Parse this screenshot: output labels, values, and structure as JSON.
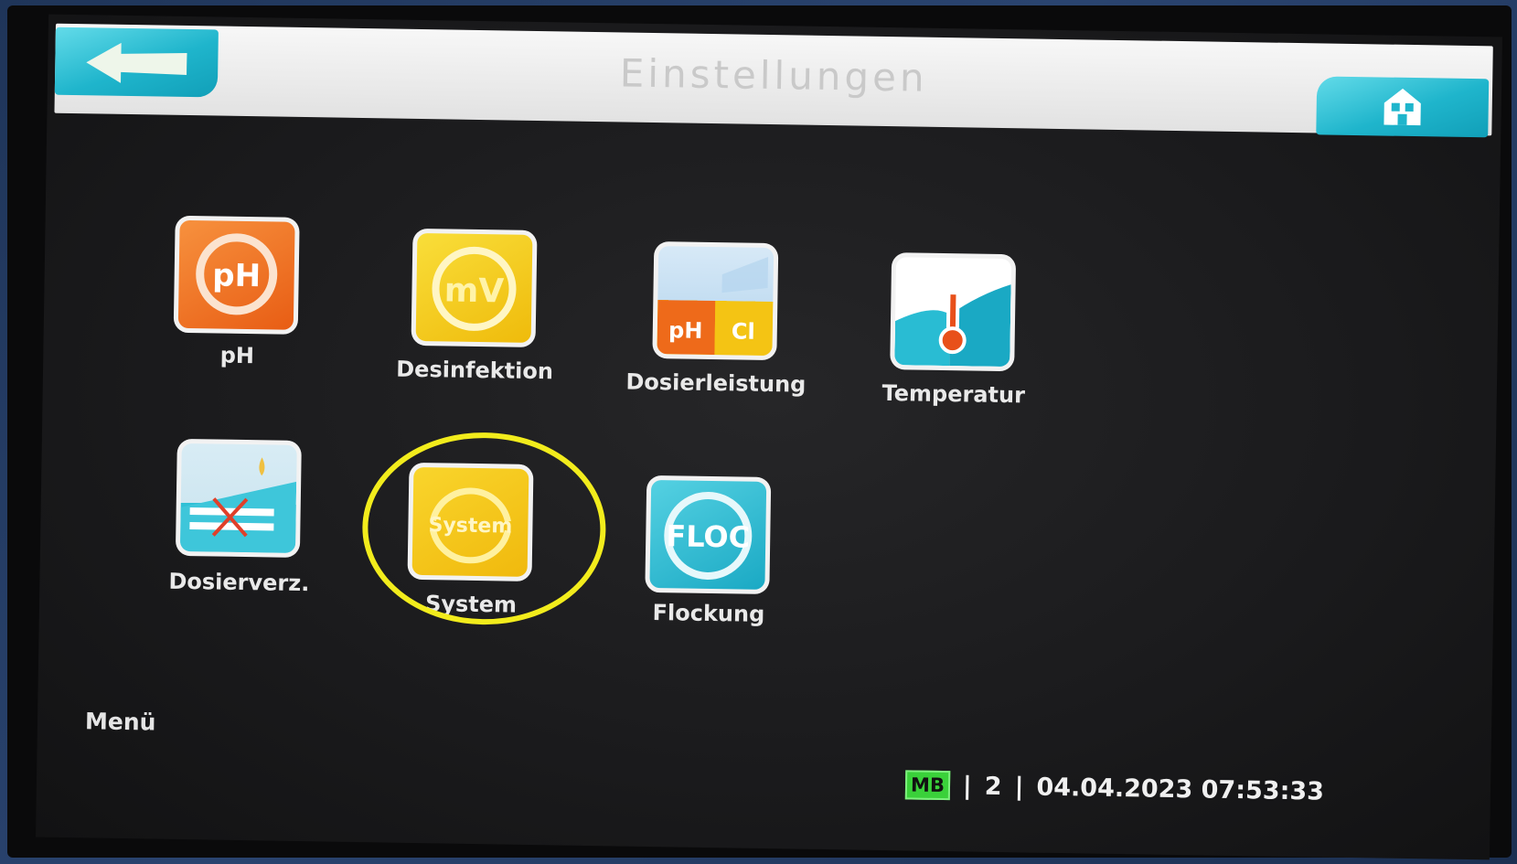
{
  "header": {
    "title": "Einstellungen",
    "back_icon": "arrow-left-icon",
    "home_icon": "house-icon"
  },
  "tiles": [
    {
      "id": "ph",
      "label": "pH",
      "icon": "ph-icon",
      "icon_text": "pH",
      "color": "#ef6a1b"
    },
    {
      "id": "desinfektion",
      "label": "Desinfektion",
      "icon": "mv-icon",
      "icon_text": "mV",
      "color": "#f2c514"
    },
    {
      "id": "dosierleistung",
      "label": "Dosierleistung",
      "icon": "ph-cl-icon",
      "icon_text_1": "pH",
      "icon_text_2": "Cl",
      "color": "#ef6a1b"
    },
    {
      "id": "temperatur",
      "label": "Temperatur",
      "icon": "thermometer-icon",
      "color": "#25bdd2"
    },
    {
      "id": "dosierverz",
      "label": "Dosierverz.",
      "icon": "dosing-delay-icon",
      "color": "#25bdd2"
    },
    {
      "id": "system",
      "label": "System",
      "icon": "system-icon",
      "icon_text": "System",
      "color": "#f2c514"
    },
    {
      "id": "flockung",
      "label": "Flockung",
      "icon": "floc-icon",
      "icon_text": "FLOC",
      "color": "#25bdd2"
    }
  ],
  "highlight": {
    "target": "system",
    "color": "#f2ec1c"
  },
  "footer": {
    "menu_label": "Menü",
    "badge": "MB",
    "page": "2",
    "datetime": "04.04.2023 07:53:33"
  }
}
